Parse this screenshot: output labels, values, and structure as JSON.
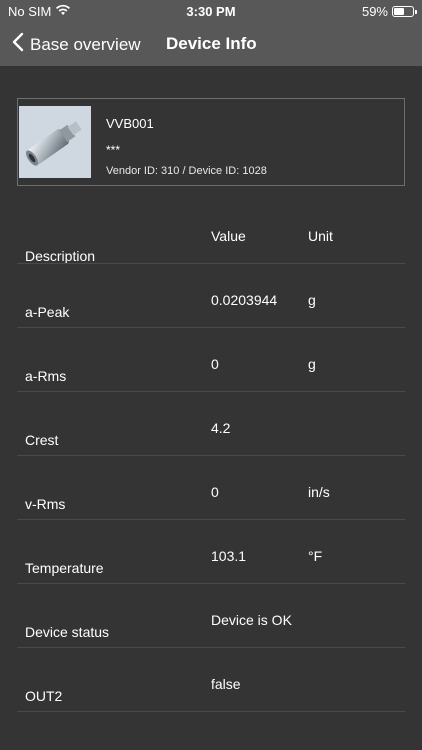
{
  "status_bar": {
    "carrier": "No SIM",
    "time": "3:30 PM",
    "battery": "59%",
    "battery_level": 0.59
  },
  "nav": {
    "back_label": "Base overview",
    "title": "Device Info"
  },
  "device": {
    "name": "VVB001",
    "stars": "***",
    "ids": "Vendor ID: 310 / Device ID: 1028"
  },
  "table": {
    "headers": {
      "description": "Description",
      "value": "Value",
      "unit": "Unit"
    },
    "rows": [
      {
        "name": "a-Peak",
        "value": "0.0203944",
        "unit": "g"
      },
      {
        "name": "a-Rms",
        "value": "0",
        "unit": "g"
      },
      {
        "name": "Crest",
        "value": "4.2",
        "unit": ""
      },
      {
        "name": "v-Rms",
        "value": "0",
        "unit": "in/s"
      },
      {
        "name": "Temperature",
        "value": "103.1",
        "unit": "°F"
      },
      {
        "name": "Device status",
        "value": "Device is OK",
        "unit": ""
      },
      {
        "name": "OUT2",
        "value": "false",
        "unit": ""
      }
    ]
  }
}
